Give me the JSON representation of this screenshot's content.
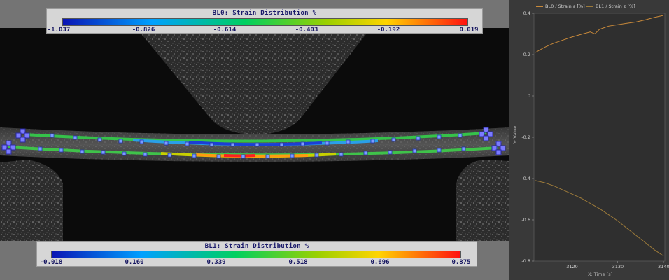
{
  "legend_top": {
    "title": "BL0: Strain Distribution %",
    "ticks": [
      "-1.037",
      "-0.826",
      "-0.614",
      "-0.403",
      "-0.192",
      "0.019"
    ]
  },
  "legend_bottom": {
    "title": "BL1: Strain Distribution %",
    "ticks": [
      "-0.018",
      "0.160",
      "0.339",
      "0.518",
      "0.696",
      "0.875"
    ]
  },
  "colors": {
    "series_bl0": "#c8893a",
    "series_bl1": "#9c7a3a",
    "plot_bg": "#393939",
    "plot_area": "#2f2f2f"
  },
  "plot": {
    "legend": [
      "BL0 /  Strain ε [%]",
      "BL1 /  Strain ε [%]"
    ],
    "y_title": "Y: Value",
    "x_title": "X: Time [s]"
  },
  "chart_data": {
    "type": "line",
    "xlabel": "X: Time [s]",
    "ylabel": "Y: Value",
    "xlim": [
      3111.7,
      3140.3
    ],
    "ylim": [
      -0.8,
      0.4
    ],
    "x_ticks": [
      3120,
      3130,
      3140
    ],
    "y_ticks": [
      0.4,
      0.2,
      0,
      -0.2,
      -0.4,
      -0.6,
      -0.8
    ],
    "y_tick_labels": [
      "0.4",
      "0.2",
      "0",
      "-0.2",
      "-0.4",
      "-0.6",
      "-0.8"
    ],
    "x_tick_labels": [
      "3120",
      "3130",
      "3140"
    ],
    "legend_position": "top",
    "grid": false,
    "series": [
      {
        "name": "BL0 /  Strain ε [%]",
        "x": [
          3112,
          3114,
          3116,
          3118,
          3120,
          3122,
          3124,
          3125,
          3126,
          3127,
          3128,
          3130,
          3132,
          3134,
          3136,
          3138,
          3140
        ],
        "y": [
          0.21,
          0.235,
          0.255,
          0.27,
          0.285,
          0.298,
          0.31,
          0.3,
          0.322,
          0.33,
          0.338,
          0.345,
          0.352,
          0.358,
          0.368,
          0.38,
          0.39
        ]
      },
      {
        "name": "BL1 /  Strain ε [%]",
        "x": [
          3112,
          3114,
          3116,
          3118,
          3120,
          3122,
          3124,
          3126,
          3128,
          3130,
          3132,
          3134,
          3136,
          3138,
          3140
        ],
        "y": [
          -0.41,
          -0.42,
          -0.435,
          -0.455,
          -0.475,
          -0.495,
          -0.52,
          -0.545,
          -0.575,
          -0.605,
          -0.64,
          -0.675,
          -0.71,
          -0.745,
          -0.775
        ]
      }
    ]
  }
}
